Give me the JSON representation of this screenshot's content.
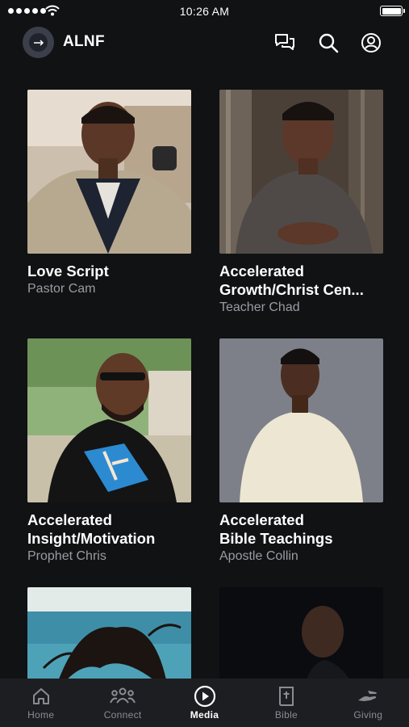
{
  "status_bar": {
    "time": "10:26 AM"
  },
  "header": {
    "app_name": "ALNF"
  },
  "cards": [
    {
      "title": "Love Script",
      "subtitle": "Pastor Cam",
      "image": "man-in-suit-photo"
    },
    {
      "title": "Accelerated Growth/Christ Cen...",
      "title_line1": "Accelerated",
      "title_line2": "Growth/Christ Cen...",
      "subtitle": "Teacher Chad",
      "image": "man-smiling-grey-shirt-photo"
    },
    {
      "title": "Accelerated Insight/Motivation",
      "title_line1": "Accelerated",
      "title_line2": "Insight/Motivation",
      "subtitle": "Prophet Chris",
      "image": "man-with-glasses-outdoor-photo"
    },
    {
      "title": "Accelerated Bible Teachings",
      "title_line1": "Accelerated",
      "title_line2": "Bible Teachings",
      "subtitle": "Apostle Collin",
      "image": "man-cream-sweater-photo"
    },
    {
      "title": "",
      "subtitle": "",
      "image": "woman-hair-ocean-photo"
    },
    {
      "title": "",
      "subtitle": "",
      "image": "man-dark-profile-photo"
    }
  ],
  "tabs": [
    {
      "label": "Home",
      "icon": "home-icon",
      "active": false
    },
    {
      "label": "Connect",
      "icon": "people-icon",
      "active": false
    },
    {
      "label": "Media",
      "icon": "play-circle-icon",
      "active": true
    },
    {
      "label": "Bible",
      "icon": "bible-icon",
      "active": false
    },
    {
      "label": "Giving",
      "icon": "giving-hand-icon",
      "active": false
    }
  ],
  "colors": {
    "background": "#111214",
    "tab_bar": "#1d1e22",
    "muted_text": "#9a9ca3",
    "inactive_tab": "#8a8c92"
  }
}
